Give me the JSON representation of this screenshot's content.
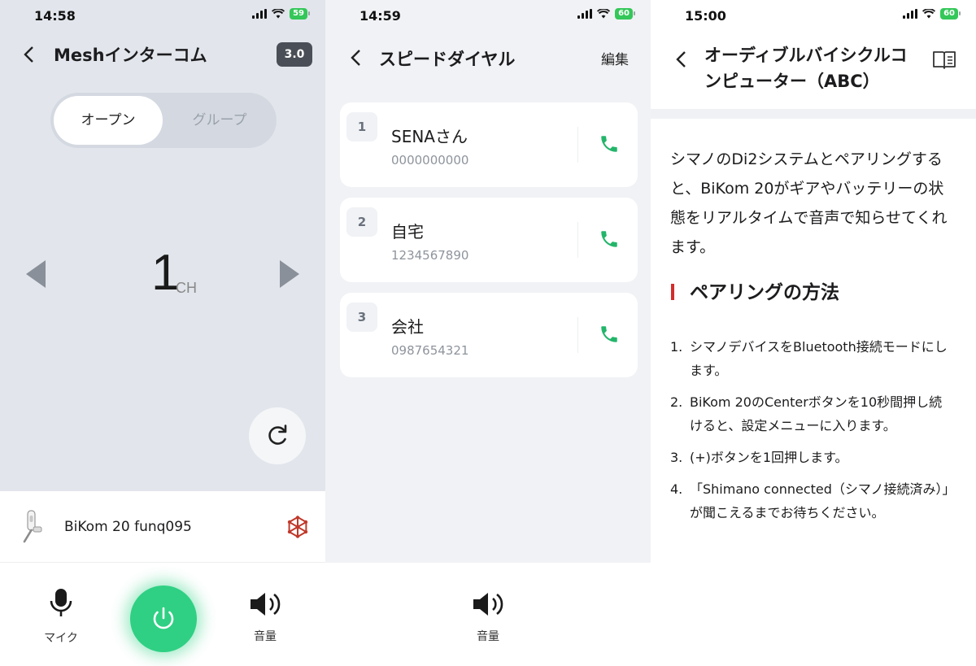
{
  "screens": {
    "mesh": {
      "status": {
        "time": "14:58",
        "battery": "59"
      },
      "title": "Meshインターコム",
      "version_badge": "3.0",
      "segment": {
        "active": "オープン",
        "inactive": "グループ"
      },
      "channel": {
        "number": "1",
        "unit": "CH"
      },
      "device_name": "BiKom 20 funq095",
      "controls": {
        "mic_label": "マイク",
        "volume_label": "音量"
      }
    },
    "speed_dial": {
      "status": {
        "time": "14:59",
        "battery": "60"
      },
      "title": "スピードダイヤル",
      "edit_label": "編集",
      "entries": [
        {
          "index": "1",
          "name": "SENAさん",
          "number": "0000000000"
        },
        {
          "index": "2",
          "name": "自宅",
          "number": "1234567890"
        },
        {
          "index": "3",
          "name": "会社",
          "number": "0987654321"
        }
      ],
      "volume_label": "音量"
    },
    "abc": {
      "status": {
        "time": "15:00",
        "battery": "60"
      },
      "title": "オーディブルバイシクルコンピューター（ABC）",
      "intro": "シマノのDi2システムとペアリングすると、BiKom 20がギアやバッテリーの状態をリアルタイムで音声で知らせてくれます。",
      "section_title": "ペアリングの方法",
      "steps": [
        {
          "n": "1.",
          "text": "シマノデバイスをBluetooth接続モードにします。"
        },
        {
          "n": "2.",
          "text": "BiKom 20のCenterボタンを10秒間押し続けると、設定メニューに入ります。"
        },
        {
          "n": "3.",
          "text": "(+)ボタンを1回押します。"
        },
        {
          "n": "4.",
          "text": "「Shimano connected（シマノ接続済み）」が聞こえるまでお待ちください。"
        }
      ]
    }
  },
  "colors": {
    "accent_green": "#2fd083",
    "call_green": "#23b56a",
    "section_red": "#d22d2d",
    "battery_green": "#34c759"
  },
  "icons": {
    "back": "chevron-left-icon",
    "mic": "microphone-icon",
    "power": "power-icon",
    "volume": "speaker-icon",
    "call": "phone-icon",
    "refresh": "refresh-icon",
    "mesh": "mesh-network-icon",
    "guide": "book-icon"
  }
}
